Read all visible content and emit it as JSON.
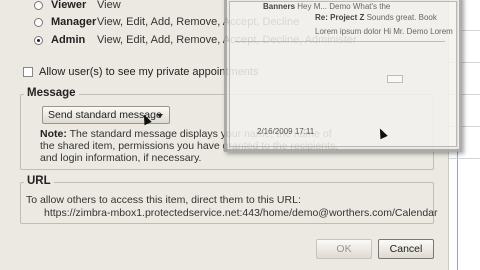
{
  "roles": [
    {
      "name": "Viewer",
      "permissions": "View",
      "selected": false
    },
    {
      "name": "Manager",
      "permissions": "View, Edit, Add, Remove, Accept, Decline",
      "selected": false
    },
    {
      "name": "Admin",
      "permissions": "View, Edit, Add, Remove, Accept, Decline, Administer",
      "selected": true
    }
  ],
  "private_appointments": {
    "label": "Allow user(s) to see my private appointments",
    "checked": false
  },
  "message": {
    "legend": "Message",
    "select_value": "Send standard message",
    "note_label": "Note:",
    "note_text": "The standard message displays your name, the name of the shared item, permissions you have granted to the recipients, and login information, if necessary."
  },
  "url": {
    "legend": "URL",
    "intro": "To allow others to access this item, direct them to this URL:",
    "link": "https://zimbra-mbox1.protectedservice.net:443/home/demo@worthers.com/Calendar"
  },
  "buttons": {
    "ok": "OK",
    "cancel": "Cancel"
  },
  "background_preview": {
    "rows": [
      {
        "sender": "Banners",
        "preview": "Hey M... Demo What's the"
      },
      {
        "sender": "Re: Project Z",
        "preview": "Sounds great. Book"
      },
      {
        "sender": "",
        "preview": "Lorem ipsum dolor",
        "extra": "Hi Mr. Demo Lorem"
      }
    ],
    "date": "2/16/2009 17:11"
  }
}
